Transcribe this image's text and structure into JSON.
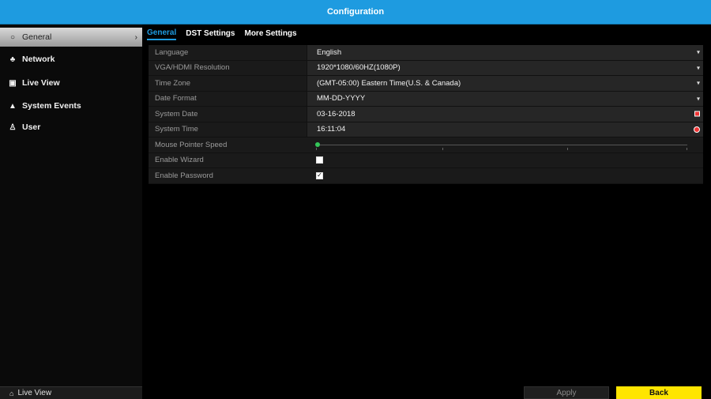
{
  "window": {
    "title": "Configuration"
  },
  "sidebar": {
    "items": [
      {
        "label": "General",
        "icon": "gear-icon",
        "active": true
      },
      {
        "label": "Network",
        "icon": "network-icon"
      },
      {
        "label": "Live View",
        "icon": "live-view-icon"
      },
      {
        "label": "System Events",
        "icon": "warning-icon"
      },
      {
        "label": "User",
        "icon": "user-icon"
      }
    ],
    "bottom_label": "Live View"
  },
  "tabs": [
    "General",
    "DST Settings",
    "More Settings"
  ],
  "settings": {
    "language": {
      "label": "Language",
      "value": "English"
    },
    "resolution": {
      "label": "VGA/HDMI Resolution",
      "value": "1920*1080/60HZ(1080P)"
    },
    "timezone": {
      "label": "Time Zone",
      "value": "(GMT-05:00) Eastern Time(U.S. & Canada)"
    },
    "date_format": {
      "label": "Date Format",
      "value": "MM-DD-YYYY"
    },
    "system_date": {
      "label": "System Date",
      "value": "03-16-2018"
    },
    "system_time": {
      "label": "System Time",
      "value": "16:11:04"
    },
    "mouse_speed": {
      "label": "Mouse Pointer Speed",
      "level": 0
    },
    "enable_wizard": {
      "label": "Enable Wizard",
      "checked": false
    },
    "enable_password": {
      "label": "Enable Password",
      "checked": true
    }
  },
  "footer": {
    "apply_label": "Apply",
    "back_label": "Back"
  },
  "colors": {
    "accent": "#1e9be0",
    "back_button": "#ffe500",
    "slider_knob": "#34c759",
    "alert": "#e33333"
  }
}
